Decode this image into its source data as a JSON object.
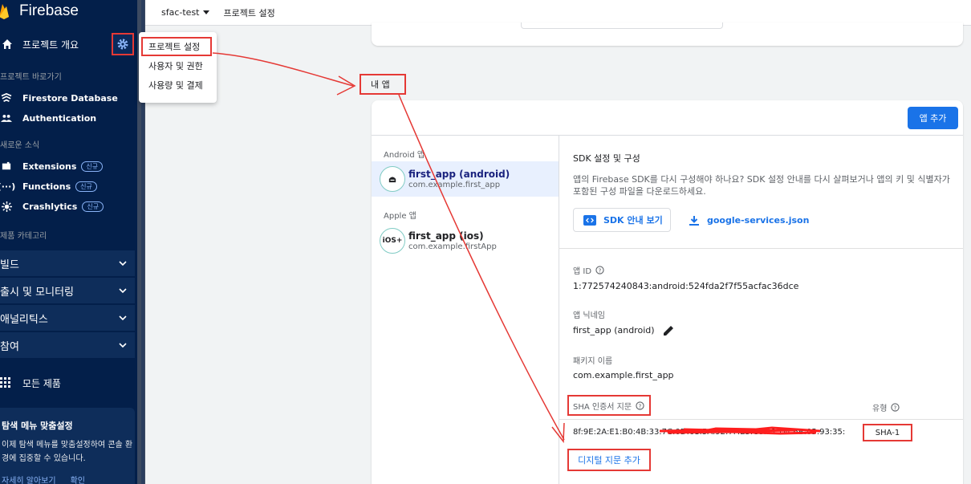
{
  "brand": {
    "name": "Firebase"
  },
  "sidebar": {
    "overview_label": "프로젝트 개요",
    "shortcuts_label": "프로젝트 바로가기",
    "shortcuts": [
      {
        "label": "Firestore Database",
        "icon": "firestore-icon"
      },
      {
        "label": "Authentication",
        "icon": "people-icon"
      }
    ],
    "news_label": "새로운 소식",
    "news": [
      {
        "label": "Extensions",
        "badge": "신규",
        "icon": "extensions-icon"
      },
      {
        "label": "Functions",
        "badge": "신규",
        "icon": "functions-icon"
      },
      {
        "label": "Crashlytics",
        "badge": "신규",
        "icon": "crashlytics-icon"
      }
    ],
    "categories_label": "제품 카테고리",
    "categories": [
      "빌드",
      "출시 및 모니터링",
      "애널리틱스",
      "참여"
    ],
    "all_products": "모든 제품",
    "customize": {
      "title": "탐색 메뉴 맞춤설정",
      "text": "이제 탐색 메뉴를 맞춤설정하여 콘솔 환경에 집중할 수 있습니다.",
      "learn_more": "자세히 알아보기",
      "ok": "확인"
    }
  },
  "topbar": {
    "project": "sfac-test",
    "crumb": "프로젝트 설정"
  },
  "dropdown": {
    "items": [
      "프로젝트 설정",
      "사용자 및 권한",
      "사용량 및 결제"
    ]
  },
  "main": {
    "my_apps_label": "내 앱",
    "add_app_button": "앱 추가",
    "android_label": "Android 앱",
    "apple_label": "Apple 앱",
    "apps": [
      {
        "icon_text": "",
        "name": "first_app (android)",
        "bundle": "com.example.first_app"
      },
      {
        "icon_text": "iOS+",
        "name": "first_app (ios)",
        "bundle": "com.example.firstApp"
      }
    ],
    "sdk_title": "SDK 설정 및 구성",
    "sdk_desc": "앱의 Firebase SDK를 다시 구성해야 하나요? SDK 설정 안내를 다시 살펴보거나 앱의 키 및 식별자가 포함된 구성 파일을 다운로드하세요.",
    "sdk_guide_button": "SDK 안내 보기",
    "config_download": "google-services.json",
    "app_id_label": "앱 ID",
    "app_id": "1:772574240843:android:524fda2f7f55acfac36dce",
    "nickname_label": "앱 닉네임",
    "nickname": "first_app (android)",
    "package_label": "패키지 이름",
    "package": "com.example.first_app",
    "sha_label": "SHA 인증서 지문",
    "type_label": "유형",
    "sha_value": "8f:9E:2A:E1:B0:4B:33:7C:0D:61:5A:92:7F:E3:C8:11:D4:6B:05:93:35:3E",
    "sha_type": "SHA-1",
    "add_fingerprint": "디지털 지문 추가"
  },
  "colors": {
    "sidebar_bg": "#031f4a",
    "accent": "#1a73e8",
    "annotation": "#e53935"
  }
}
